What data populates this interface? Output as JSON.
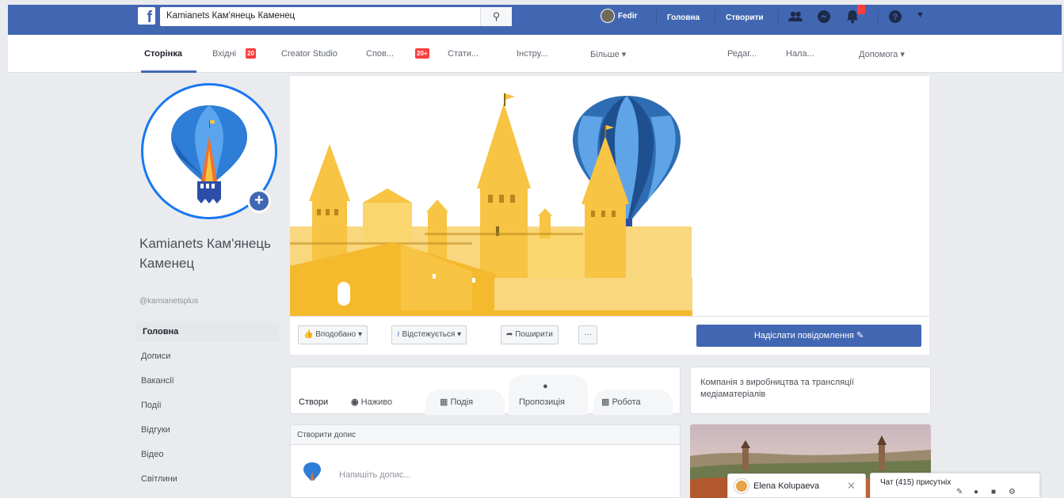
{
  "topbar": {
    "search_value": "Kamianets Кам'янець Каменец",
    "user_name": "Fedir",
    "home_label": "Головна",
    "create_label": "Створити"
  },
  "pagenav": {
    "page": "Сторінка",
    "inbox": "Вхідні",
    "inbox_badge": "20",
    "creator_studio": "Creator Studio",
    "notifications": "Спов...",
    "notifications_badge": "20+",
    "stats": "Стати...",
    "tools": "Інстру...",
    "more": "Більше ▾",
    "edit": "Редаг...",
    "settings": "Нала...",
    "help": "Допомога ▾"
  },
  "left": {
    "page_name": "Kamianets Кам'янець Каменец",
    "handle": "@kamianetsplus",
    "nav": [
      "Головна",
      "Дописи",
      "Вакансії",
      "Події",
      "Відгуки",
      "Відео",
      "Світлини"
    ]
  },
  "actions": {
    "liked": "Вподобано ▾",
    "following": "Відстежується ▾",
    "share": "Поширити",
    "more": "···",
    "send_message": "Надіслати повідомлення"
  },
  "create": {
    "label": "Створи",
    "live": "Наживо",
    "event": "Подія",
    "offer": "Пропозиція",
    "job": "Робота"
  },
  "post": {
    "header": "Створити допис",
    "placeholder": "Напишіть допис..."
  },
  "about": {
    "category": "Компанія з виробництва та трансляції медіаматеріалів"
  },
  "chat": {
    "contact": "Elena Kolupaeva",
    "online": "Чат (415) присутніх"
  },
  "colors": {
    "brand_blue": "#4267b2",
    "badge_red": "#fa3e3e",
    "castle_yellow": "#f7c443",
    "balloon_blue": "#2e6db4"
  }
}
